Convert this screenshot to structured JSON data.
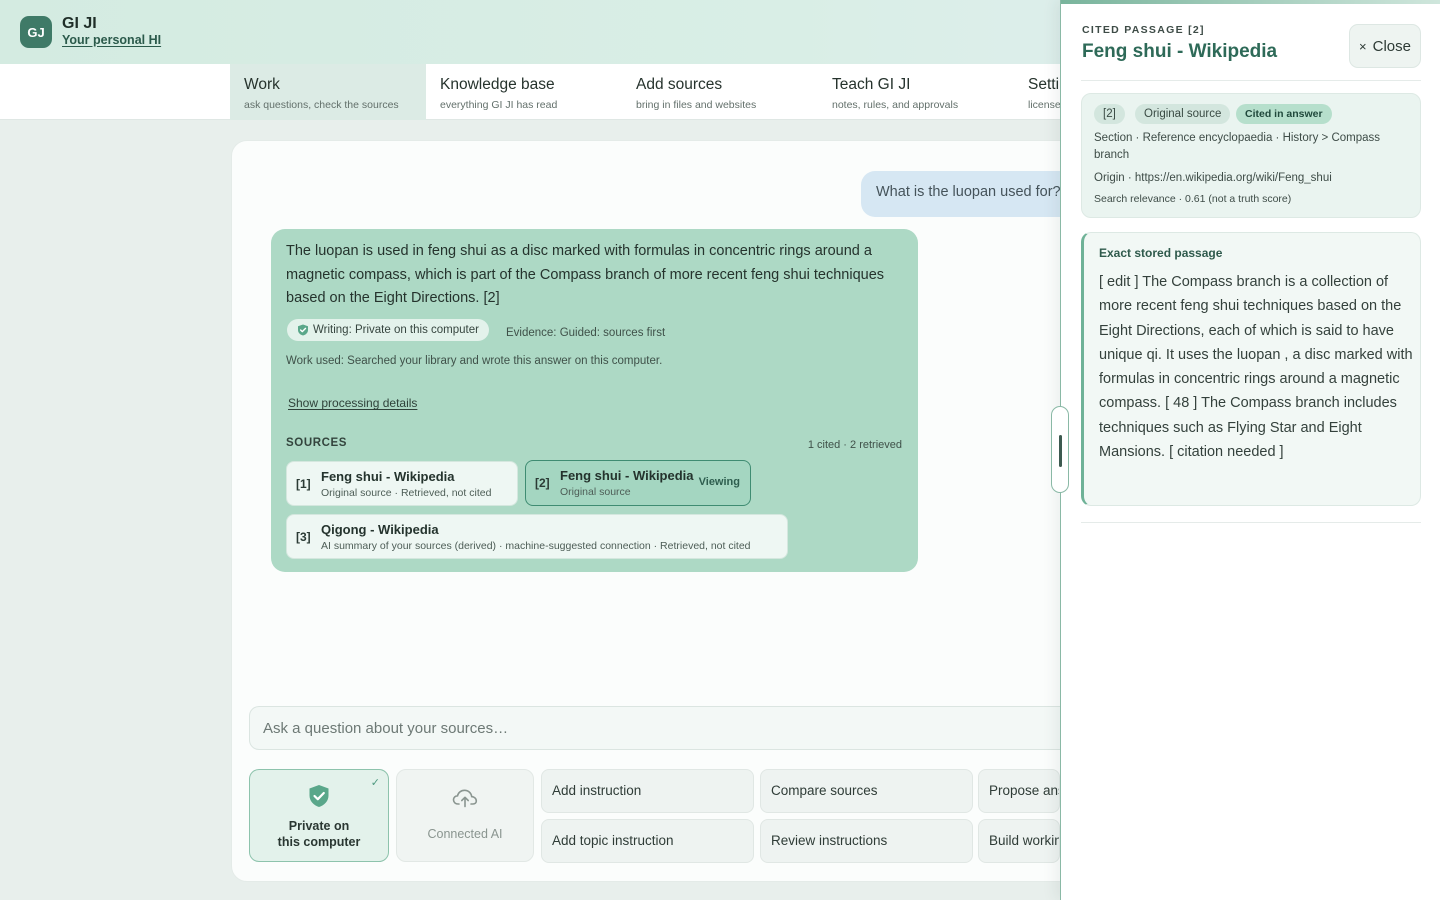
{
  "app": {
    "avatar_initials": "GJ",
    "name": "GI JI",
    "subtitle": "Your personal HI"
  },
  "tabs": [
    {
      "title": "Work",
      "subtitle": "ask questions, check the sources",
      "active": true
    },
    {
      "title": "Knowledge base",
      "subtitle": "everything GI JI has read"
    },
    {
      "title": "Add sources",
      "subtitle": "bring in files and websites"
    },
    {
      "title": "Teach GI JI",
      "subtitle": "notes, rules, and approvals"
    },
    {
      "title": "Settings",
      "subtitle": "licenses"
    }
  ],
  "conversation": {
    "user_question": "What is the luopan used for?",
    "answer": {
      "text": "The luopan is used in feng shui as a disc marked with formulas in concentric rings around a magnetic compass, which is part of the Compass branch of more recent feng shui techniques based on the Eight Directions. [2]",
      "writing_pill": "Writing: Private on this computer",
      "evidence": "Evidence: Guided: sources first",
      "work_used": "Work used: Searched your library and wrote this answer on this computer.",
      "show_details": "Show processing details",
      "sources_heading": "SOURCES",
      "sources_count": "1 cited · 2 retrieved",
      "sources": [
        {
          "num": "[1]",
          "title": "Feng shui - Wikipedia",
          "sub": "Original source · Retrieved, not cited"
        },
        {
          "num": "[2]",
          "title": "Feng shui - Wikipedia",
          "sub": "Original source",
          "status": "Viewing"
        },
        {
          "num": "[3]",
          "title": "Qigong - Wikipedia",
          "sub": "AI summary of your sources (derived) · machine-suggested connection · Retrieved, not cited"
        }
      ]
    }
  },
  "composer": {
    "placeholder": "Ask a question about your sources…",
    "modes": [
      {
        "label_line1": "Private on",
        "label_line2": "this computer",
        "selected": true,
        "icon": "shield-check-icon"
      },
      {
        "label": "Connected AI",
        "selected": false,
        "icon": "cloud-upload-icon"
      }
    ],
    "actions": [
      "Add instruction",
      "Compare sources",
      "Propose answer",
      "Add topic instruction",
      "Review instructions",
      "Build working"
    ]
  },
  "panel": {
    "kicker": "CITED PASSAGE [2]",
    "title": "Feng shui - Wikipedia",
    "close_label": "Close",
    "badges": [
      "[2]",
      "Original source",
      "Cited in answer"
    ],
    "section": "Section · Reference encyclopaedia · History > Compass branch",
    "origin": "Origin · https://en.wikipedia.org/wiki/Feng_shui",
    "relevance": "Search relevance · 0.61 (not a truth score)",
    "passage_heading": "Exact stored passage",
    "passage": "[ edit ] The Compass branch is a collection of more recent feng shui techniques based on the Eight Directions, each of which is said to have unique qi. It uses the luopan , a disc marked with formulas in concentric rings around a magnetic compass. [ 48 ] The Compass branch includes techniques such as Flying Star and Eight Mansions. [ citation needed ]"
  },
  "colors": {
    "accent": "#3f7a67",
    "answer_bg": "#add9c5",
    "user_bubble_bg": "#d6e7f3",
    "panel_title": "#2e6a58"
  }
}
